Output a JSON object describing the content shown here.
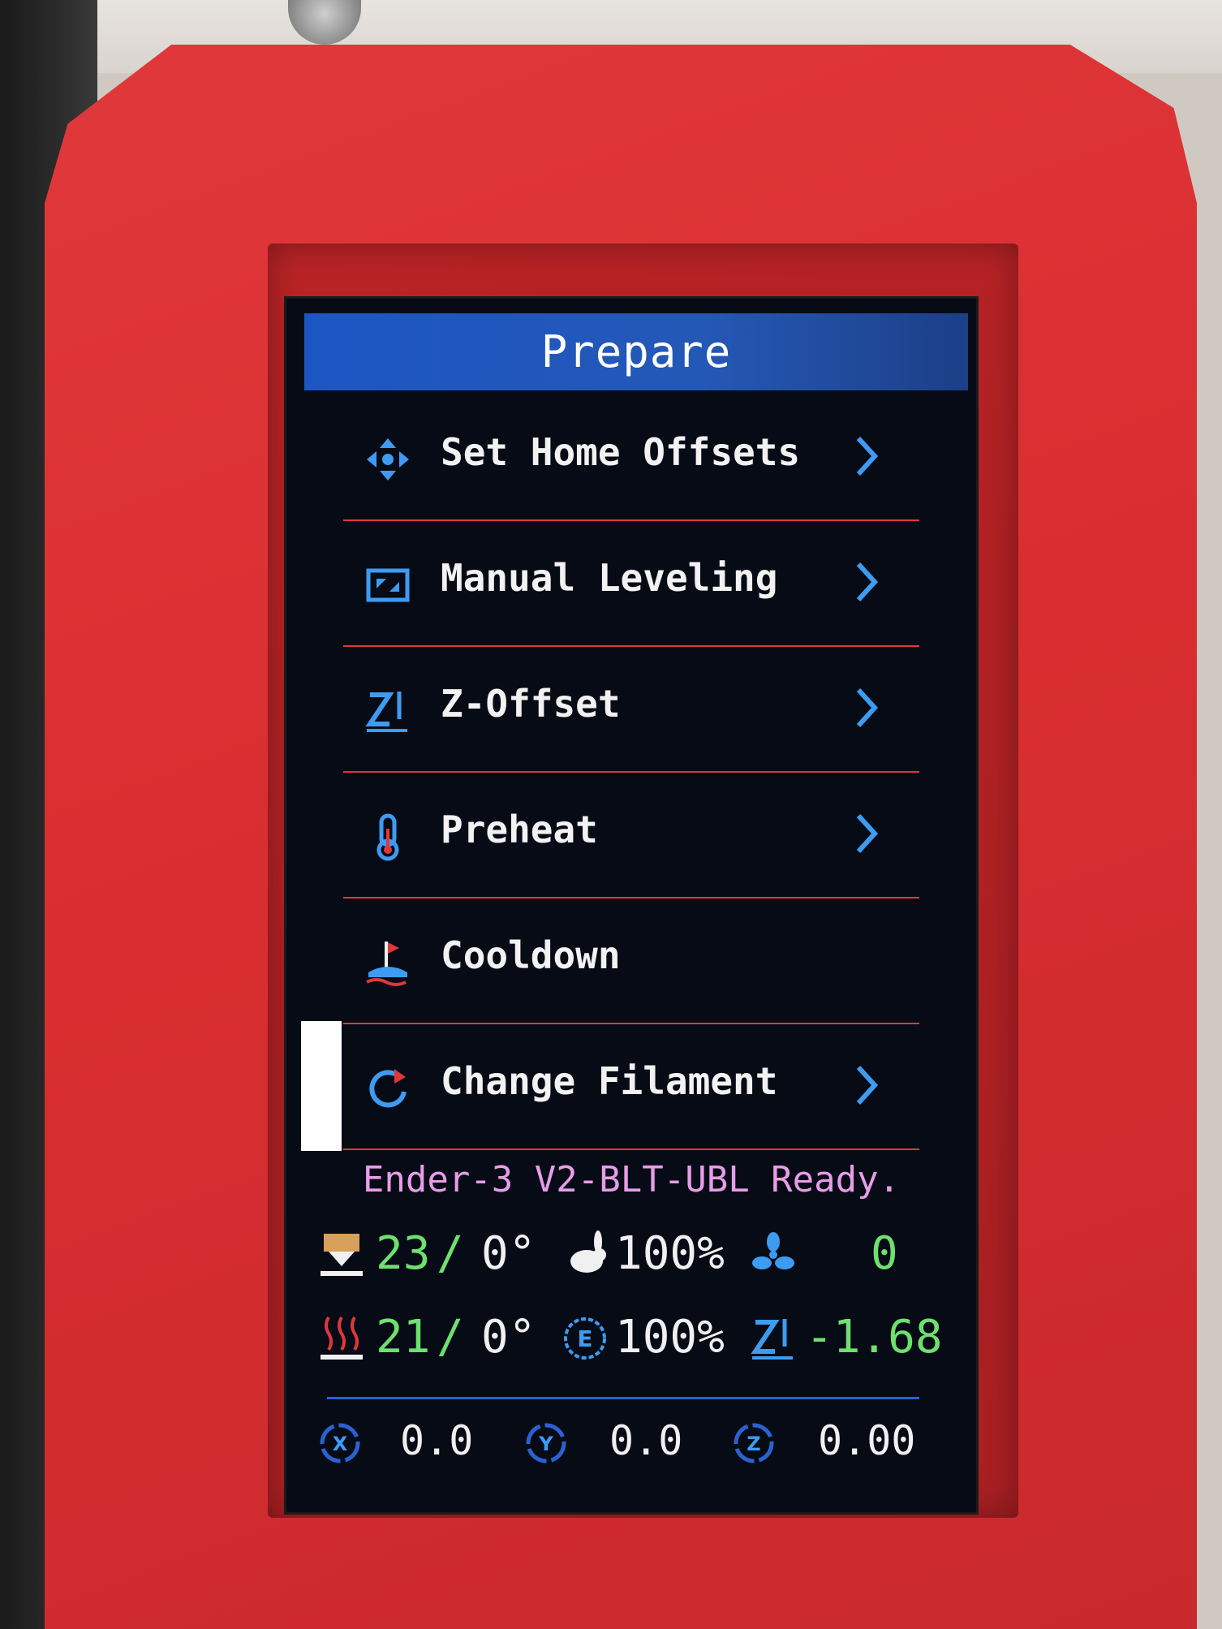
{
  "screen": {
    "title": "Prepare",
    "menu": [
      {
        "label": "Set Home Offsets",
        "icon": "move-arrows-icon",
        "has_submenu": true
      },
      {
        "label": "Manual Leveling",
        "icon": "leveling-icon",
        "has_submenu": true
      },
      {
        "label": "Z-Offset",
        "icon": "z-offset-icon",
        "has_submenu": true
      },
      {
        "label": "Preheat",
        "icon": "thermometer-icon",
        "has_submenu": true
      },
      {
        "label": "Cooldown",
        "icon": "cooldown-icon",
        "has_submenu": false
      },
      {
        "label": "Change Filament",
        "icon": "refresh-icon",
        "has_submenu": true,
        "selected": true
      }
    ],
    "status_message": "Ender-3 V2-BLT-UBL Ready.",
    "stats": {
      "hotend_temp": "23",
      "hotend_target": "0°",
      "feedrate": "100%",
      "fan": "0",
      "bed_temp": "21",
      "bed_target": "0°",
      "flow": "100%",
      "z_offset": "-1.68"
    },
    "axes": {
      "x": "0.0",
      "y": "0.0",
      "z": "0.00"
    }
  },
  "colors": {
    "title_bar": "#1d56c4",
    "divider": "#e0373a",
    "icon_blue": "#3d9cf2",
    "status_text": "#e89de8",
    "value_green": "#6ee06e",
    "case_red": "#d92e31"
  }
}
